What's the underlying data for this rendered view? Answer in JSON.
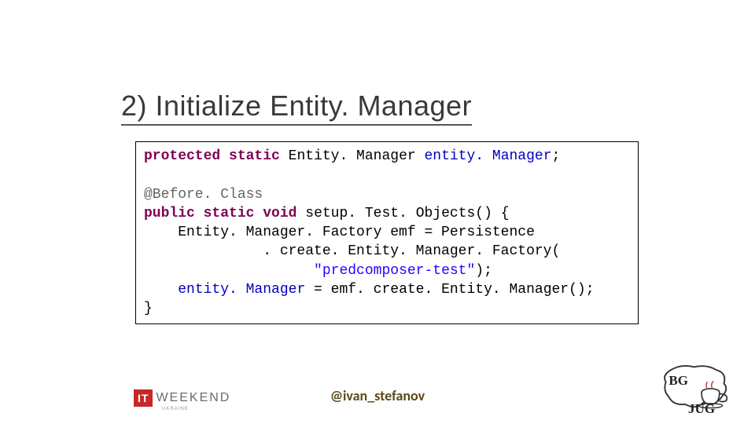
{
  "slide": {
    "title": "2) Initialize Entity. Manager",
    "code": {
      "l1_kw1": "protected",
      "l1_kw2": "static",
      "l1_rest": " Entity. Manager ",
      "l1_fld": "entity. Manager",
      "l1_semi": ";",
      "blank1": " ",
      "l2_ann": "@Before. Class",
      "l3_kw1": "public",
      "l3_kw2": "static",
      "l3_kw3": "void",
      "l3_rest": " setup. Test. Objects() {",
      "l4": "    Entity. Manager. Factory emf = Persistence",
      "l5": "              . create. Entity. Manager. Factory(",
      "l6_pre": "                    ",
      "l6_str": "\"predcomposer-test\"",
      "l6_post": ");",
      "l7_pre": "    ",
      "l7_fld": "entity. Manager",
      "l7_post": " = emf. create. Entity. Manager();",
      "l8": "}"
    }
  },
  "footer": {
    "handle": "@ivan_stefanov",
    "itw_it": "IT",
    "itw_weekend": "WEEKEND",
    "itw_country": "UKRAINE",
    "bgjug_bg": "BG",
    "bgjug_jug": "JUG"
  }
}
